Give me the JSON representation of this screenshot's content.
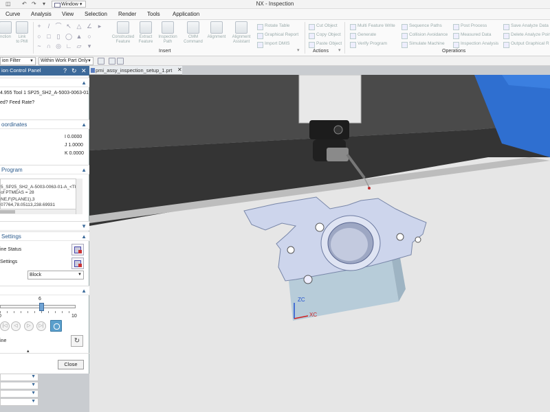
{
  "window": {
    "app_title": "NX - Inspection",
    "window_dropdown": "Window"
  },
  "menu": [
    "Curve",
    "Analysis",
    "View",
    "Selection",
    "Render",
    "Tools",
    "Application"
  ],
  "ribbon": {
    "sketch_cut_label": "nction",
    "sketch_cut_label2": "Link\nto PMI",
    "insert_buttons": [
      "Constructed\nFeature",
      "Extract\nFeature",
      "Inspection\nPath",
      "CMM\nCommand",
      "Alignment",
      "Alignment\nAssistant"
    ],
    "insert_group_label": "Insert",
    "misc_rows": [
      "Rotate Table",
      "Graphical Report",
      "Import DMIS"
    ],
    "actions_rows": [
      "Cut Object",
      "Copy Object",
      "Paste Object"
    ],
    "actions_group_label": "Actions",
    "operations_col1": [
      "Multi Feature Write",
      "Generate",
      "Verify Program"
    ],
    "operations_col2": [
      "Sequence Paths",
      "Collision Avoidance",
      "Simulate Machine"
    ],
    "operations_col3": [
      "Post Process",
      "Measured Data",
      "Inspection Analysis"
    ],
    "operations_col4": [
      "Save Analyze Data",
      "Delete Analyze Poin",
      "Output Graphical R"
    ],
    "operations_group_label": "Operations"
  },
  "filterbar": {
    "selection_filter": "ion Filter",
    "scope": "Within Work Part Only"
  },
  "panel": {
    "title": "ion Control Panel",
    "header_buttons": [
      "?",
      "↻",
      "✕"
    ],
    "tool_line": "4.955  Tool 1     SP25_SH2_A-5003-0063-01",
    "feed_line": "ed?     Feed Rate?",
    "coords_title": "oordinates",
    "coords": [
      "I 0.0000",
      "J 1.0000",
      "K 0.0000"
    ],
    "program_title": " Program",
    "program_lines": [
      "5_SP25_SH2_A-5003-0063-01-A_<TP_",
      " of PTMEAS = 28",
      "NE,F(PLANE1),3",
      "07764,78.05113,238.69931"
    ],
    "settings_title": " Settings",
    "machine_status_label": "ine Status",
    "settings_label": "Settings",
    "block_dropdown": "Block",
    "slider_value": "6",
    "slider_min": "0",
    "slider_max": "10",
    "slider_position": 0.6,
    "playback_buttons": [
      "|◁",
      "◁",
      "▷",
      "▷|"
    ],
    "line_label": "ine",
    "close_label": "Close",
    "collapse_arrow": "▴"
  },
  "graphics": {
    "tab_label": "pmi_assy_inspection_setup_1.prt",
    "tab_close": "✕",
    "axis_zc": "ZC",
    "axis_xc": "XC"
  },
  "colors": {
    "panel_header": "#3d6a9a",
    "section_text": "#2a5a8c",
    "floor": "#e6e6e6",
    "backdrop_dark": "#3b3b3b",
    "machine_blue": "#2f6fd0",
    "block_blue": "#b7ccd9",
    "part_blue": "#cdd5ec"
  }
}
